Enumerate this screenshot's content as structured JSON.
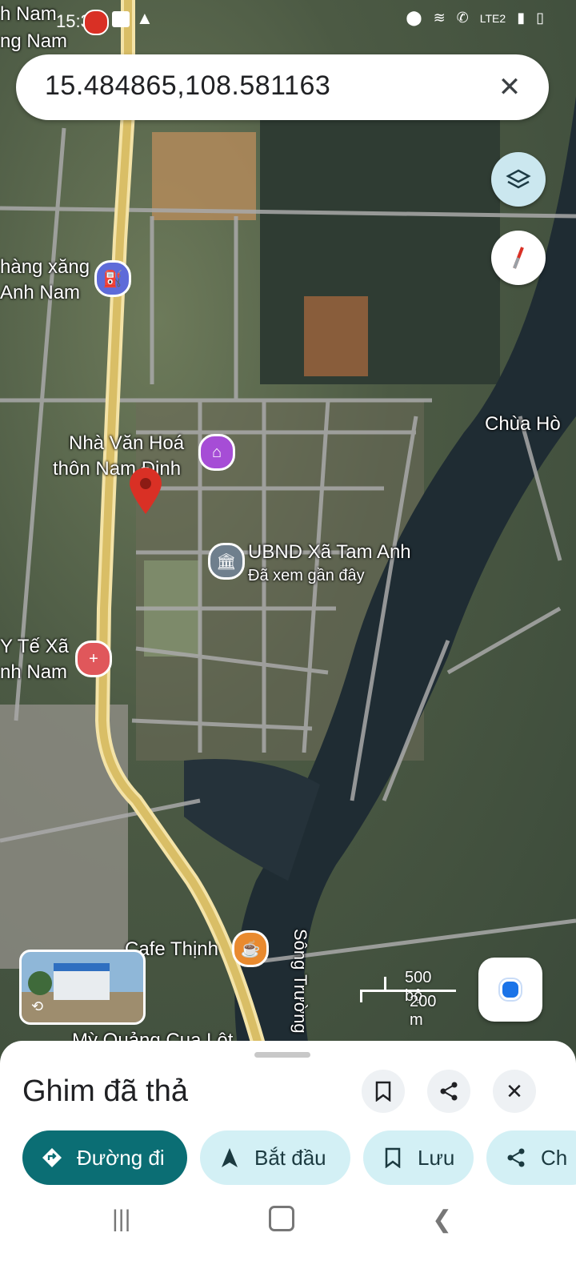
{
  "status_bar": {
    "time": "15:38",
    "network": "LTE2"
  },
  "search": {
    "value": "15.484865,108.581163",
    "close_icon": "close-icon"
  },
  "map": {
    "labels": {
      "top_left_1": "h Nam",
      "top_left_2": "ng Nam",
      "gas_1": "hàng xăng",
      "gas_2": "Anh Nam",
      "culture_1": "Nhà Văn Hoá",
      "culture_2": "thôn Nam Định",
      "ubnd": "UBND Xã Tam Anh",
      "ubnd_sub": "Đã xem gần đây",
      "pagoda": "Chùa Hò",
      "health_1": "Y Tế Xã",
      "health_2": "nh Nam",
      "cafe": "Cafe Thịnh",
      "river": "Sông Trường",
      "restaurant": "Mỳ Quảng Cua Lột"
    },
    "scale": {
      "imperial": "500 bộ",
      "metric": "200 m"
    }
  },
  "sheet": {
    "title": "Ghim đã thả",
    "actions": {
      "directions": "Đường đi",
      "start": "Bắt đầu",
      "save": "Lưu",
      "share": "Ch"
    }
  },
  "colors": {
    "accent": "#0b6e74",
    "chip_bg": "#d3f0f5",
    "pin_red": "#d93025",
    "road_yellow": "#e8cf7c"
  }
}
